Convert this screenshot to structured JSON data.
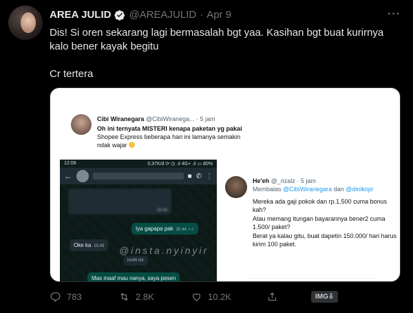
{
  "tweet": {
    "display_name": "AREA JULID",
    "handle": "@AREAJULID",
    "dot": "·",
    "date": "Apr 9",
    "more": "···",
    "text_line1": "Dis! Si oren sekarang lagi bermasalah bgt yaa. Kasihan bgt buat kurirnya kalo bener kayak begitu",
    "text_line2": "Cr tertera"
  },
  "media": {
    "embedded_tweet": {
      "name": "Cibi Wiranegara",
      "handle_time": "@CibiWiranega... · 5 jam",
      "text_bold": "Oh ini ternyata MISTERI kenapa paketan yg pakai",
      "text_rest": " Shopee Express beberapa hari ini lamanya semakin ndak wajar"
    },
    "phone": {
      "time": "12:08",
      "status_right": "0,37K/d ⟳ ◷ .ıl 4G+ .ıl ▭ 80%",
      "messages": [
        {
          "text": "20.43"
        },
        {
          "text": "Iya gapapa pak",
          "time": "20.44 ✓✓"
        },
        {
          "text": "Oke ka",
          "time": "20.43"
        },
        {
          "text": "HARI INI"
        },
        {
          "text": "Mas maaf mau nanya, saya pesen"
        }
      ],
      "watermark": "@insta.nyinyir"
    },
    "reply": {
      "name": "He'eh",
      "handle_time": "@_rizalz · 5 jam",
      "reply_prefix": "Membalas ",
      "reply_link1": "@CibiWiranegara",
      "reply_mid": " dan ",
      "reply_link2": "@dinikopi",
      "lines": [
        "Mereka ada gaji pokok dan rp.1.500 cuma bonus kah?",
        "Atau memang itungan bayarannya bener2 cuma 1.500/ paket?",
        "Berat ya kalau gitu, buat dapetin 150.000/ hari harus kirim 100 paket."
      ]
    }
  },
  "actions": {
    "replies": "783",
    "retweets": "2.8K",
    "likes": "10.2K",
    "img_label": "IMG⇩"
  },
  "colors": {
    "background": "#000000",
    "primary_text": "#e7e9ea",
    "secondary_text": "#71767b",
    "verified": "#1d9bf0"
  }
}
